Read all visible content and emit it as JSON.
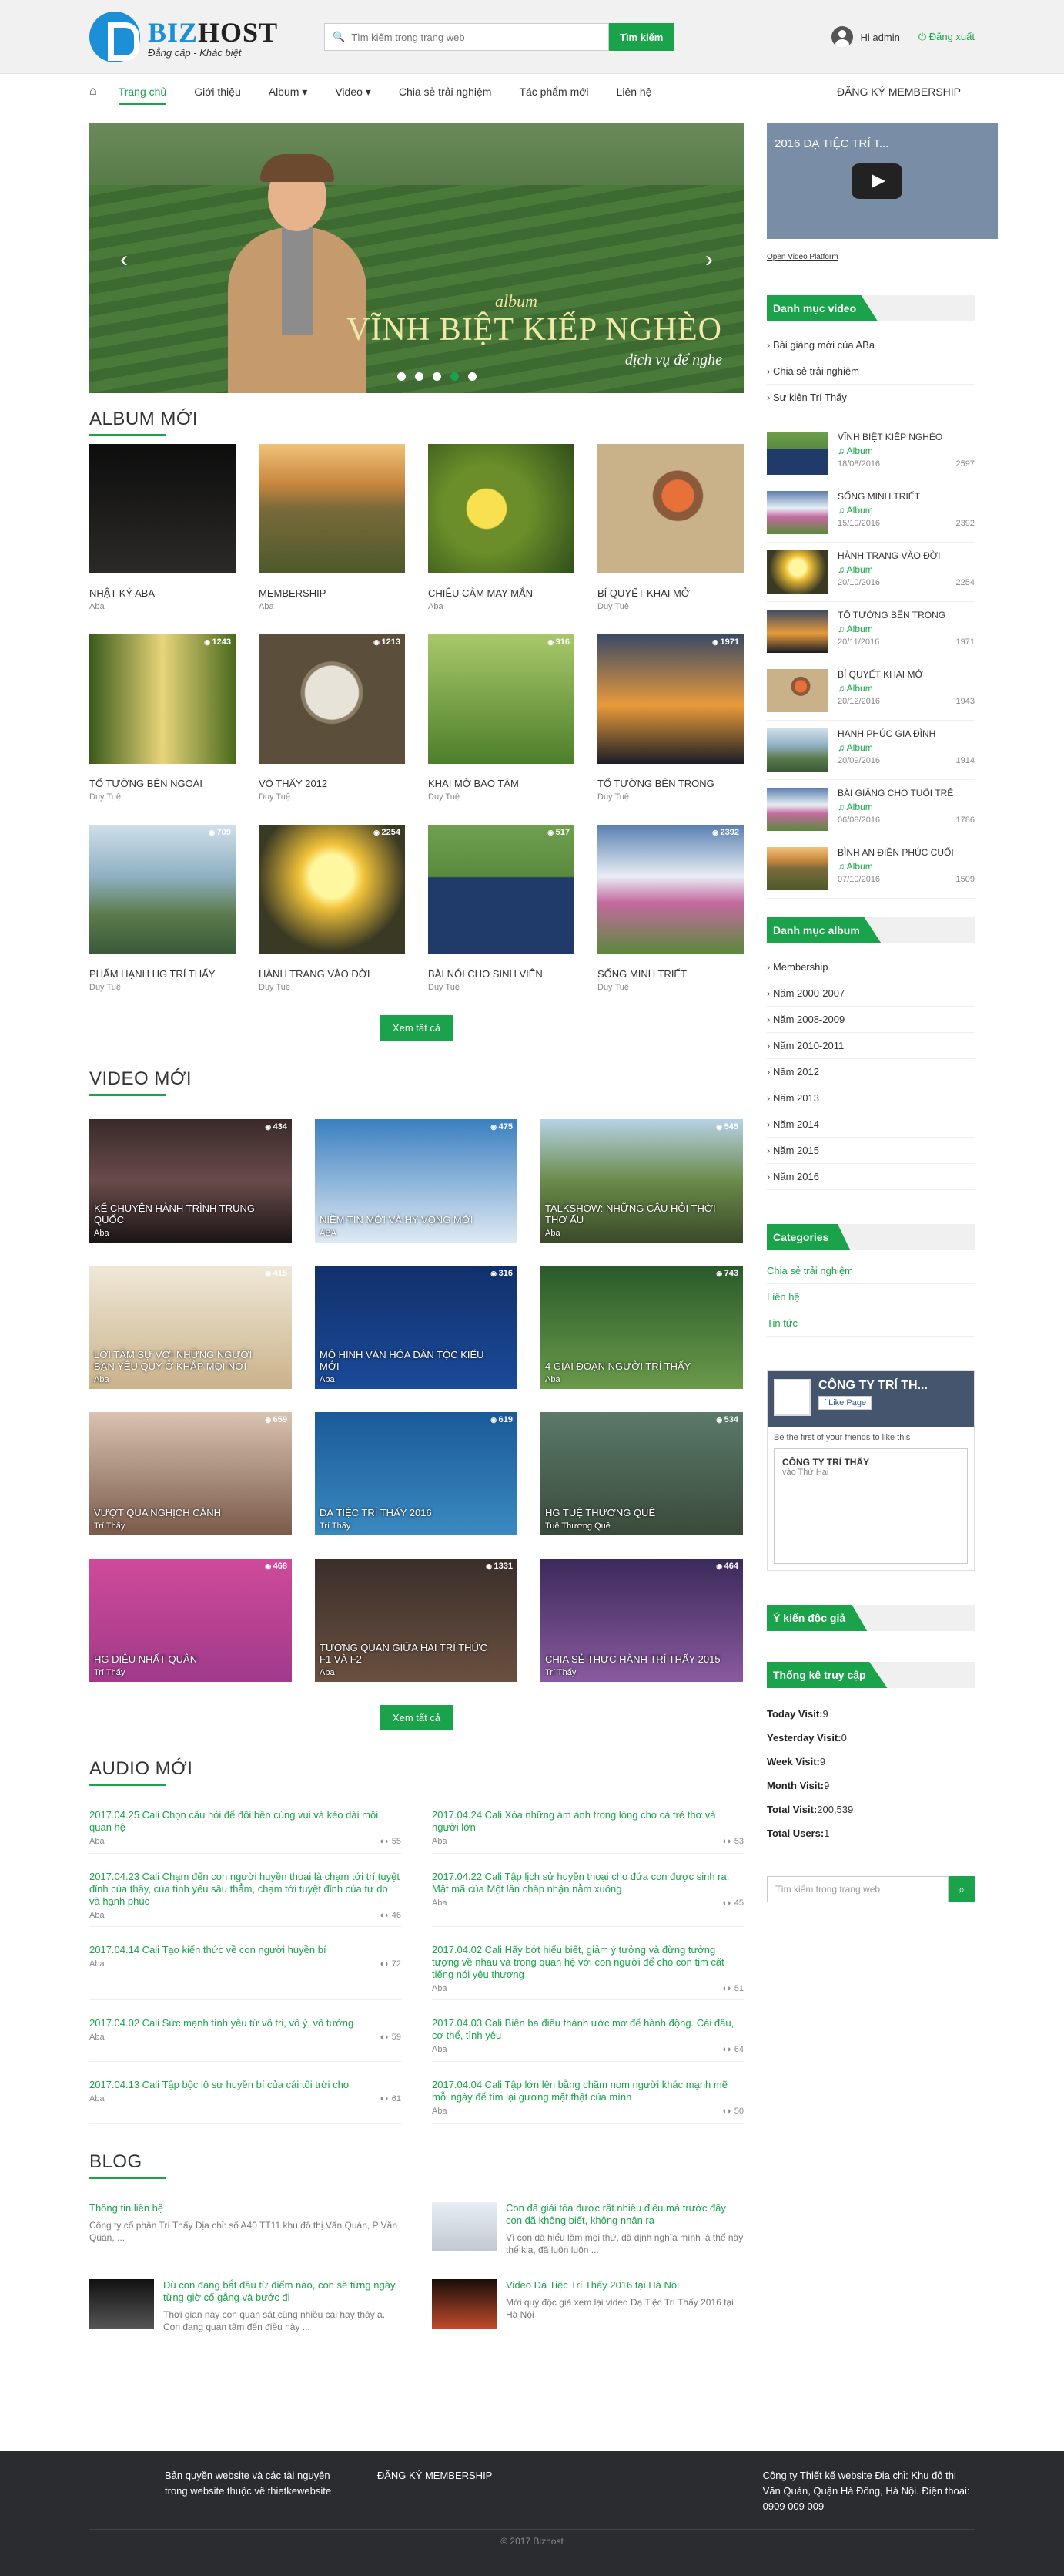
{
  "header": {
    "logo_name_a": "BIZ",
    "logo_name_b": "HOST",
    "logo_tagline": "Đẳng cấp - Khác biệt",
    "search_placeholder": "Tìm kiếm trong trang web",
    "search_button": "Tìm kiếm",
    "greeting": "Hi admin",
    "logout": "Đăng xuất"
  },
  "nav": {
    "items": [
      "Trang chủ",
      "Giới thiệu",
      "Album ▾",
      "Video ▾",
      "Chia sẻ trải nghiệm",
      "Tác phẩm mới",
      "Liên hệ"
    ],
    "right": "ĐĂNG KÝ MEMBERSHIP"
  },
  "slider": {
    "caption_small": "album",
    "caption_big": "VĨNH BIỆT KIẾP NGHÈO",
    "caption_sub": "dịch vụ để nghe"
  },
  "albums": {
    "title": "ALBUM MỚI",
    "items": [
      {
        "name": "NHẬT KÝ ABA",
        "by": "Aba",
        "count": ""
      },
      {
        "name": "MEMBERSHIP",
        "by": "Aba",
        "count": ""
      },
      {
        "name": "CHIÊU CẢM MAY MẮN",
        "by": "Aba",
        "count": ""
      },
      {
        "name": "BÍ QUYẾT KHAI MỞ",
        "by": "Duy Tuệ",
        "count": ""
      },
      {
        "name": "TỔ TƯỜNG BÊN NGOÀI",
        "by": "Duy Tuệ",
        "count": "1243"
      },
      {
        "name": "VÔ THẤY 2012",
        "by": "Duy Tuệ",
        "count": "1213"
      },
      {
        "name": "KHAI MỞ BAO TÂM",
        "by": "Duy Tuệ",
        "count": "916"
      },
      {
        "name": "TỔ TƯỜNG BÊN TRONG",
        "by": "Duy Tuệ",
        "count": "1971"
      },
      {
        "name": "PHẨM HẠNH HG TRÍ THẤY",
        "by": "Duy Tuệ",
        "count": "709"
      },
      {
        "name": "HÀNH TRANG VÀO ĐỜI",
        "by": "Duy Tuệ",
        "count": "2254"
      },
      {
        "name": "BÀI NÓI CHO SINH VIÊN",
        "by": "Duy Tuệ",
        "count": "517"
      },
      {
        "name": "SỐNG MINH TRIẾT",
        "by": "Duy Tuệ",
        "count": "2392"
      }
    ],
    "more": "Xem tất cả"
  },
  "videos": {
    "title": "VIDEO MỚI",
    "items": [
      {
        "title": "KỂ CHUYỆN HÀNH TRÌNH TRUNG QUỐC",
        "by": "Aba",
        "count": "434"
      },
      {
        "title": "NIỀM TIN MỚI VÀ HY VỌNG MỚI",
        "by": "ABA",
        "count": "475"
      },
      {
        "title": "TALKSHOW: NHỮNG CÂU HỎI THỜI THƠ ẤU",
        "by": "Aba",
        "count": "545"
      },
      {
        "title": "LỜI TÂM SỰ VỚI NHỮNG NGƯỜI BẠN YÊU QUÝ Ở KHẮP MỌI NƠI",
        "by": "Aba",
        "count": "415"
      },
      {
        "title": "MÔ HÌNH VĂN HÓA DÂN TỘC KIỂU MỚI",
        "by": "Aba",
        "count": "316"
      },
      {
        "title": "4 GIAI ĐOẠN NGƯỜI TRÍ THẤY",
        "by": "Aba",
        "count": "743"
      },
      {
        "title": "VƯỢT QUA NGHỊCH CẢNH",
        "by": "Trí Thấy",
        "count": "659"
      },
      {
        "title": "DẠ TIỆC TRÍ THẤY 2016",
        "by": "Trí Thấy",
        "count": "619"
      },
      {
        "title": "HG Tuệ Thương Quê",
        "by": "Tuệ Thương Quê",
        "count": "534"
      },
      {
        "title": "HG Diệu Nhất Quân",
        "by": "Trí Thấy",
        "count": "468"
      },
      {
        "title": "Tương quan giữa hai trí thức F1 và F2",
        "by": "Aba",
        "count": "1331"
      },
      {
        "title": "Chia sẻ thực hành Trí Thấy 2015",
        "by": "Trí Thấy",
        "count": "464"
      }
    ],
    "more": "Xem tất cả"
  },
  "audio": {
    "title": "AUDIO MỚI",
    "items": [
      {
        "title": "2017.04.25 Cali Chọn câu hỏi để đôi bên cùng vui và kéo dài mối quan hệ",
        "by": "Aba",
        "count": "55"
      },
      {
        "title": "2017.04.24 Cali Xóa những ám ảnh trong lòng cho cả trẻ thơ và người lớn",
        "by": "Aba",
        "count": "53"
      },
      {
        "title": "2017.04.23 Cali Chạm đến con người huyền thoại là chạm tới trí tuyệt đỉnh của thấy, của tình yêu sâu thẳm, chạm tới tuyệt đỉnh của tự do và hạnh phúc",
        "by": "Aba",
        "count": "46"
      },
      {
        "title": "2017.04.22 Cali Tập lịch sử huyền thoại cho đứa con được sinh ra. Mặt mã của Một lần chấp nhận nằm xuống",
        "by": "Aba",
        "count": "45"
      },
      {
        "title": "2017.04.14 Cali Tạo kiến thức về con người huyền bí",
        "by": "Aba",
        "count": "72"
      },
      {
        "title": "2017.04.02 Cali Hãy bớt hiểu biết, giảm ý tưởng và đừng tưởng tượng về nhau và trong quan hệ với con người để cho con tim cất tiếng nói yêu thương",
        "by": "Aba",
        "count": "51"
      },
      {
        "title": "2017.04.02 Cali Sức mạnh tình yêu từ vô tri, vô ý, vô tưởng",
        "by": "Aba",
        "count": "59"
      },
      {
        "title": "2017.04.03 Cali Biến ba điều thành ước mơ để hành động. Cái đầu, cơ thể, tình yêu",
        "by": "Aba",
        "count": "64"
      },
      {
        "title": "2017.04.13 Cali Tập bộc lộ sự huyền bí của cái tôi trời cho",
        "by": "Aba",
        "count": "61"
      },
      {
        "title": "2017.04.04 Cali Tập lớn lên bằng chăm nom người khác mạnh mẽ mỗi ngày để tìm lại gương mặt thật của mình",
        "by": "Aba",
        "count": "50"
      }
    ]
  },
  "blog": {
    "title": "BLOG",
    "items": [
      {
        "title": "Thông tin liên hệ",
        "desc": "Công ty cổ phần Trí Thấy Địa chỉ: số A40 TT11 khu đô thị Văn Quán, P Văn Quán, ..."
      },
      {
        "title": "Con đã giải tỏa được rất nhiều điều mà trước đây con đã không biết, không nhận ra",
        "desc": "Vì con đã hiểu lầm mọi thứ, đã định nghĩa mình là thế này thế kia, đã luôn luôn ..."
      },
      {
        "title": "Dù con đang bắt đầu từ điểm nào, con sẽ từng ngày, từng giờ cố gắng và bước đi",
        "desc": "Thời gian này con quan sát cũng nhiều cái hay thầy a. Con đang quan tâm đến điều này ..."
      },
      {
        "title": "Video Dạ Tiệc Trí Thấy 2016 tại Hà Nội",
        "desc": "Mời quý độc giả xem lại video Dạ Tiệc Trí Thấy 2016 tại Hà Nội"
      }
    ]
  },
  "sidebar": {
    "video_title": "2016 DẠ TIỆC TRÍ T...",
    "video_link": "Open Video Platform",
    "video_cat_title": "Danh mục video",
    "video_cats": [
      "Bài giảng mới của ABa",
      "Chia sẻ trải nghiệm",
      "Sự kiện Trí Thấy"
    ],
    "albums": [
      {
        "title": "VĨNH BIỆT KIẾP NGHÈO",
        "cat": "Album",
        "date": "18/08/2016",
        "count": "2597"
      },
      {
        "title": "SỐNG MINH TRIẾT",
        "cat": "Album",
        "date": "15/10/2016",
        "count": "2392"
      },
      {
        "title": "HÀNH TRANG VÀO ĐỜI",
        "cat": "Album",
        "date": "20/10/2016",
        "count": "2254"
      },
      {
        "title": "TỔ TƯỜNG BÊN TRONG",
        "cat": "Album",
        "date": "20/11/2016",
        "count": "1971"
      },
      {
        "title": "BÍ QUYẾT KHAI MỞ",
        "cat": "Album",
        "date": "20/12/2016",
        "count": "1943"
      },
      {
        "title": "HẠNH PHÚC GIA ĐÌNH",
        "cat": "Album",
        "date": "20/09/2016",
        "count": "1914"
      },
      {
        "title": "BÀI GIẢNG CHO TUỔI TRẺ",
        "cat": "Album",
        "date": "06/08/2016",
        "count": "1786"
      },
      {
        "title": "BÌNH AN ĐIỀN PHÚC CUỐI",
        "cat": "Album",
        "date": "07/10/2016",
        "count": "1509"
      }
    ],
    "album_cat_title": "Danh mục album",
    "album_cats": [
      "Membership",
      "Năm 2000-2007",
      "Năm 2008-2009",
      "Năm 2010-2011",
      "Năm 2012",
      "Năm 2013",
      "Năm 2014",
      "Năm 2015",
      "Năm 2016"
    ],
    "categories_title": "Categories",
    "categories": [
      "Chia sẻ trải nghiệm",
      "Liên hệ",
      "Tin tức"
    ],
    "fb_name": "CÔNG TY TRÍ TH...",
    "fb_like": "Like Page",
    "fb_note": "Be the first of your friends to like this",
    "fb_inner_name": "CÔNG TY TRÍ THẤY",
    "fb_inner_sub": "vào Thứ Hai",
    "opinion_title": "Ý kiến độc giả",
    "stats_title": "Thống kê truy cập",
    "stats": [
      {
        "label": "Today Visit:",
        "value": "9"
      },
      {
        "label": "Yesterday Visit:",
        "value": "0"
      },
      {
        "label": "Week Visit:",
        "value": "9"
      },
      {
        "label": "Month Visit:",
        "value": "9"
      },
      {
        "label": "Total Visit:",
        "value": "200,539"
      },
      {
        "label": "Total Users:",
        "value": "1"
      }
    ],
    "search_placeholder": "Tìm kiếm trong trang web"
  },
  "footer": {
    "col1": "Bản quyền website và các tài nguyên trong website thuộc về thietkewebsite",
    "col2": "ĐĂNG KÝ MEMBERSHIP",
    "col3": "Công ty Thiết kế website Địa chỉ: Khu đô thị Văn Quán, Quận Hà Đông, Hà Nội. Điện thoại: 0909 009 009",
    "copyright": "© 2017 Bizhost"
  },
  "colors": {
    "accent": "#1aa34a",
    "brand": "#1d8fd6",
    "footer": "#2a2c30"
  }
}
